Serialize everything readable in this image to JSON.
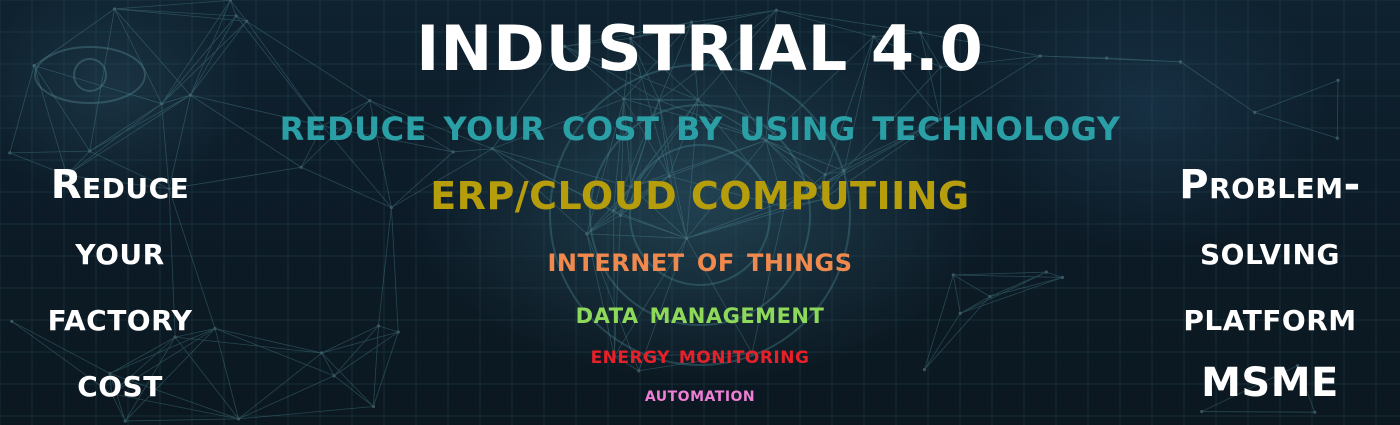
{
  "banner": {
    "title": "INDUSTRIAL 4.0",
    "subtitle": "Reduce your cost by using Technology",
    "items": [
      "ERP/CLOUD COMPUTIING",
      "Internet of things",
      "Data management",
      "Energy monitoring",
      "Automation"
    ],
    "left_lines": [
      "Reduce",
      "your",
      "factory",
      "cost"
    ],
    "right_lines": [
      "Problem-",
      "solving",
      "platform",
      "MSME"
    ]
  },
  "colors": {
    "background": "#0c1a26",
    "title": "#ffffff",
    "subtitle": "#2aa0a6",
    "erp": "#b69d0c",
    "iot": "#f0894e",
    "data_management": "#8fd95a",
    "energy_monitoring": "#e8202a",
    "automation": "#ef7fd6"
  }
}
